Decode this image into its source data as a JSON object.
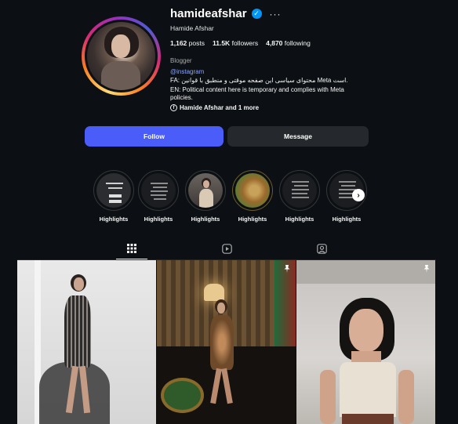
{
  "profile": {
    "username": "hamideafshar",
    "full_name": "Hamide Afshar",
    "more_label": "···",
    "verified_mark": "✓",
    "stats": [
      {
        "value": "1,162",
        "label": "posts"
      },
      {
        "value": "11.5K",
        "label": "followers"
      },
      {
        "value": "4,870",
        "label": "following"
      }
    ],
    "category": "Blogger",
    "link": "@instagram",
    "bio_fa": "FA: محتوای سیاسی این صفحه موقتی و منطبق با قوانین Meta است.",
    "bio_en": "EN: Political content here is temporary and complies with Meta policies.",
    "facebook_link": "Hamide Afshar and 1 more",
    "facebook_glyph": "f"
  },
  "actions": {
    "follow_label": "Follow",
    "message_label": "Message"
  },
  "highlights": {
    "items": [
      {
        "label": "Highlights",
        "style": "note-light"
      },
      {
        "label": "Highlights",
        "style": "note-dark"
      },
      {
        "label": "Highlights",
        "style": "woman"
      },
      {
        "label": "Highlights",
        "style": "lion"
      },
      {
        "label": "Highlights",
        "style": "note-dark"
      },
      {
        "label": "Highlights",
        "style": "note-dark"
      }
    ],
    "next_glyph": "›"
  },
  "tabs": {
    "items": [
      {
        "name": "posts-grid",
        "active": true
      },
      {
        "name": "reels",
        "active": false
      },
      {
        "name": "tagged",
        "active": false
      }
    ]
  },
  "posts": {
    "items": [
      {
        "description": "woman in corset dress on studio backdrop",
        "pinned": false
      },
      {
        "description": "woman in leopard dress in lounge",
        "pinned": true
      },
      {
        "description": "woman in strapless top indoors",
        "pinned": true
      }
    ],
    "pin_glyph": "📌"
  },
  "colors": {
    "background": "#0c1014",
    "follow_button": "#4a5df9",
    "message_button": "#25292e",
    "verified": "#0095f6",
    "link": "#8aa4ff"
  }
}
